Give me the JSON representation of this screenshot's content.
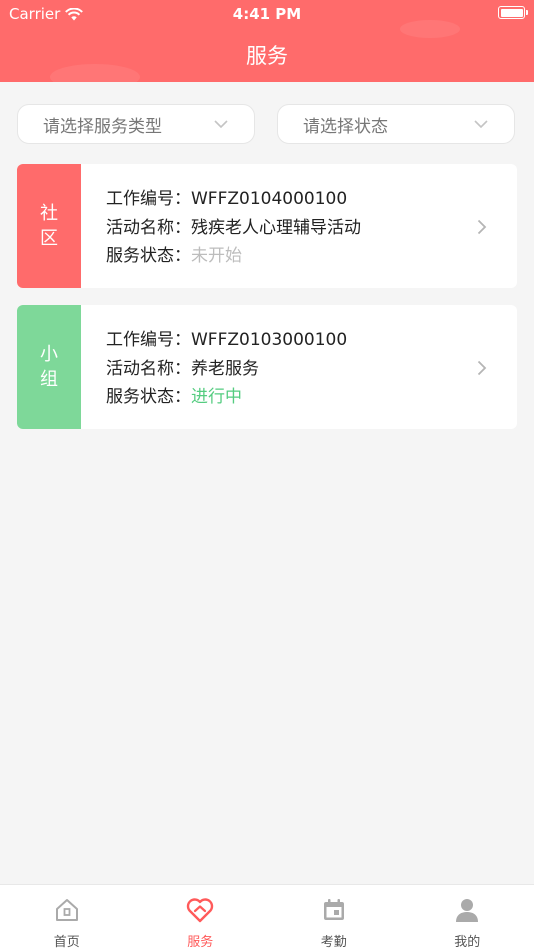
{
  "status_bar": {
    "carrier": "Carrier",
    "time": "4:41 PM"
  },
  "header": {
    "title": "服务"
  },
  "filters": [
    {
      "placeholder": "请选择服务类型"
    },
    {
      "placeholder": "请选择状态"
    }
  ],
  "cards": [
    {
      "tag_chars": [
        "社",
        "区"
      ],
      "tag_color": "#ff6b6b",
      "work_no_label": "工作编号：",
      "work_no": "WFFZ0104000100",
      "activity_label": "活动名称：",
      "activity": "残疾老人心理辅导活动",
      "status_label": "服务状态：",
      "status": "未开始",
      "status_color": "#bdbdbd"
    },
    {
      "tag_chars": [
        "小",
        "组"
      ],
      "tag_color": "#7ed899",
      "work_no_label": "工作编号：",
      "work_no": "WFFZ0103000100",
      "activity_label": "活动名称：",
      "activity": "养老服务",
      "status_label": "服务状态：",
      "status": "进行中",
      "status_color": "#55cc80"
    }
  ],
  "tabs": [
    {
      "label": "首页",
      "icon": "home-icon",
      "active": false
    },
    {
      "label": "服务",
      "icon": "heart-icon",
      "active": true
    },
    {
      "label": "考勤",
      "icon": "calendar-icon",
      "active": false
    },
    {
      "label": "我的",
      "icon": "user-icon",
      "active": false
    }
  ],
  "colors": {
    "accent": "#ff6b6b",
    "active_tab": "#ff5a5a"
  }
}
